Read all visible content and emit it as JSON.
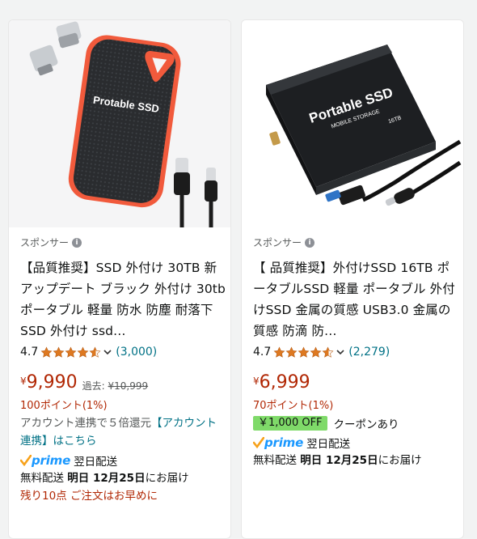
{
  "products": [
    {
      "sponsored_label": "スポンサー",
      "image_text": "Protable SSD",
      "title": "【品質推奨】SSD 外付け 30TB 新アップデート ブラック 外付け 30tb ポータブル 軽量 防水 防塵 耐落下 SSD 外付け ssd…",
      "rating": "4.7",
      "review_count": "(3,000)",
      "currency": "¥",
      "price": "9,990",
      "past_label": "過去:",
      "past_price": "¥10,999",
      "points": "100ポイント(1%)",
      "account_text": "アカウント連携で５倍還元",
      "account_link": "【アカウント連携】はこちら",
      "prime_label": "prime",
      "prime_delivery": "翌日配送",
      "shipping_prefix": "無料配送",
      "shipping_day": "明日 12月25日",
      "shipping_suffix": "にお届け",
      "stock_note": "残り10点 ご注文はお早めに"
    },
    {
      "sponsored_label": "スポンサー",
      "image_text_line1": "Portable SSD",
      "image_text_line2": "MOBILE STORAGE",
      "image_text_line3": "16TB",
      "title": "【 品質推奨】外付けSSD 16TB ポータブルSSD 軽量 ポータブル 外付けSSD 金属の質感 USB3.0 金属の質感 防滴 防…",
      "rating": "4.7",
      "review_count": "(2,279)",
      "currency": "¥",
      "price": "6,999",
      "points": "70ポイント(1%)",
      "coupon_badge": "￥1,000 OFF",
      "coupon_text": "クーポンあり",
      "prime_label": "prime",
      "prime_delivery": "翌日配送",
      "shipping_prefix": "無料配送",
      "shipping_day": "明日 12月25日",
      "shipping_suffix": "にお届け"
    }
  ],
  "colors": {
    "price": "#b12704",
    "link": "#007185",
    "star": "#de7921",
    "prime": "#1a98ff",
    "coupon_bg": "#7fda69"
  }
}
